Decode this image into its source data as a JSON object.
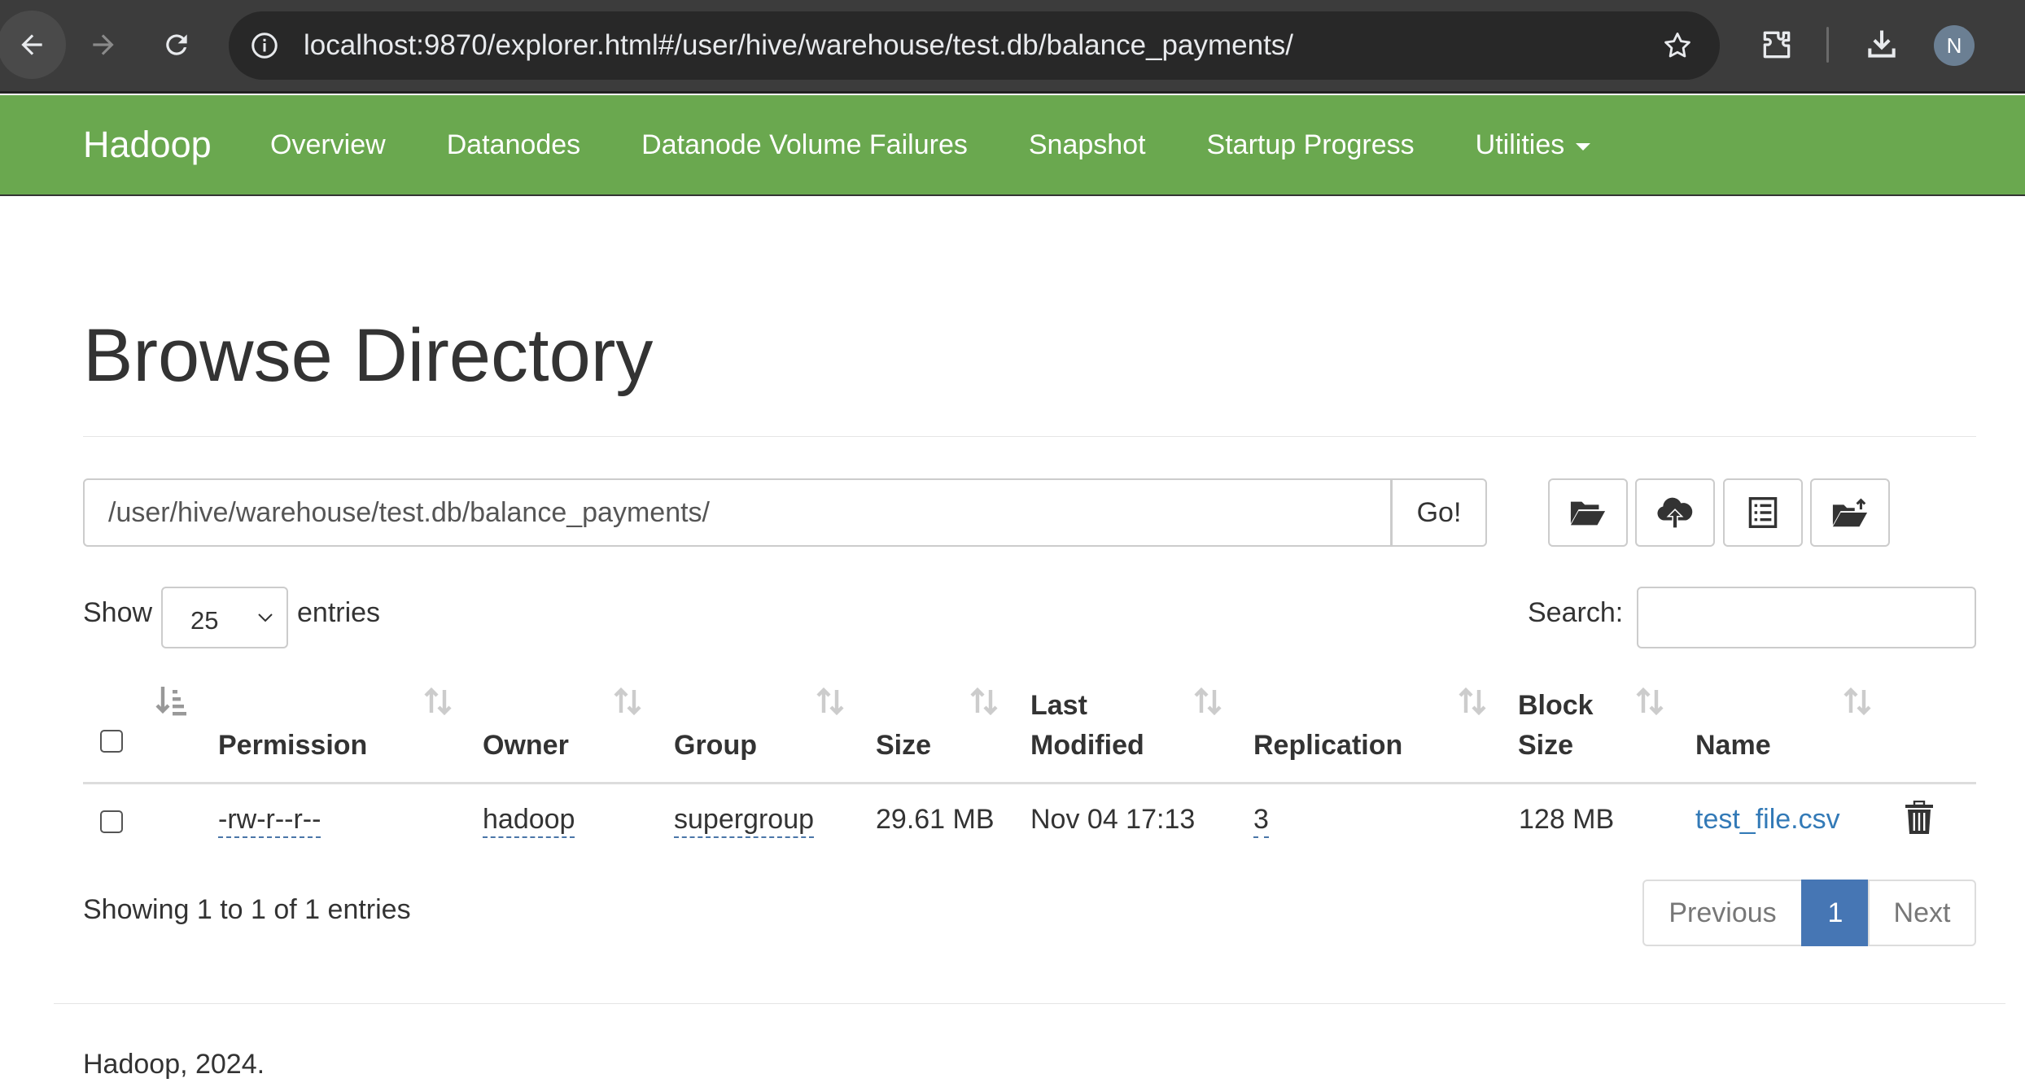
{
  "browser": {
    "url": "localhost:9870/explorer.html#/user/hive/warehouse/test.db/balance_payments/",
    "profile_initial": "N"
  },
  "navbar": {
    "brand": "Hadoop",
    "items": [
      {
        "label": "Overview"
      },
      {
        "label": "Datanodes"
      },
      {
        "label": "Datanode Volume Failures"
      },
      {
        "label": "Snapshot"
      },
      {
        "label": "Startup Progress"
      },
      {
        "label": "Utilities"
      }
    ],
    "color": "#6aa84f"
  },
  "page": {
    "title": "Browse Directory"
  },
  "path_bar": {
    "value": "/user/hive/warehouse/test.db/balance_payments/",
    "go_label": "Go!",
    "tools": [
      {
        "icon": "folder-open-icon"
      },
      {
        "icon": "cloud-upload-icon"
      },
      {
        "icon": "list-alt-icon"
      },
      {
        "icon": "folder-upload-icon"
      }
    ]
  },
  "table_controls": {
    "show_label": "Show",
    "entries_value": "25",
    "entries_label": "entries",
    "search_label": "Search:",
    "search_value": ""
  },
  "table": {
    "headers": {
      "permission": "Permission",
      "owner": "Owner",
      "group": "Group",
      "size": "Size",
      "last_modified_1": "Last",
      "last_modified_2": "Modified",
      "replication": "Replication",
      "block_size_1": "Block",
      "block_size_2": "Size",
      "name": "Name"
    },
    "rows": [
      {
        "permission": "-rw-r--r--",
        "owner": "hadoop",
        "group": "supergroup",
        "size": "29.61 MB",
        "last_modified": "Nov 04 17:13",
        "replication": "3",
        "block_size": "128 MB",
        "name": "test_file.csv"
      }
    ]
  },
  "pagination": {
    "info": "Showing 1 to 1 of 1 entries",
    "previous": "Previous",
    "current": "1",
    "next": "Next",
    "accent": "#4676b4"
  },
  "footer": {
    "text": "Hadoop, 2024."
  }
}
